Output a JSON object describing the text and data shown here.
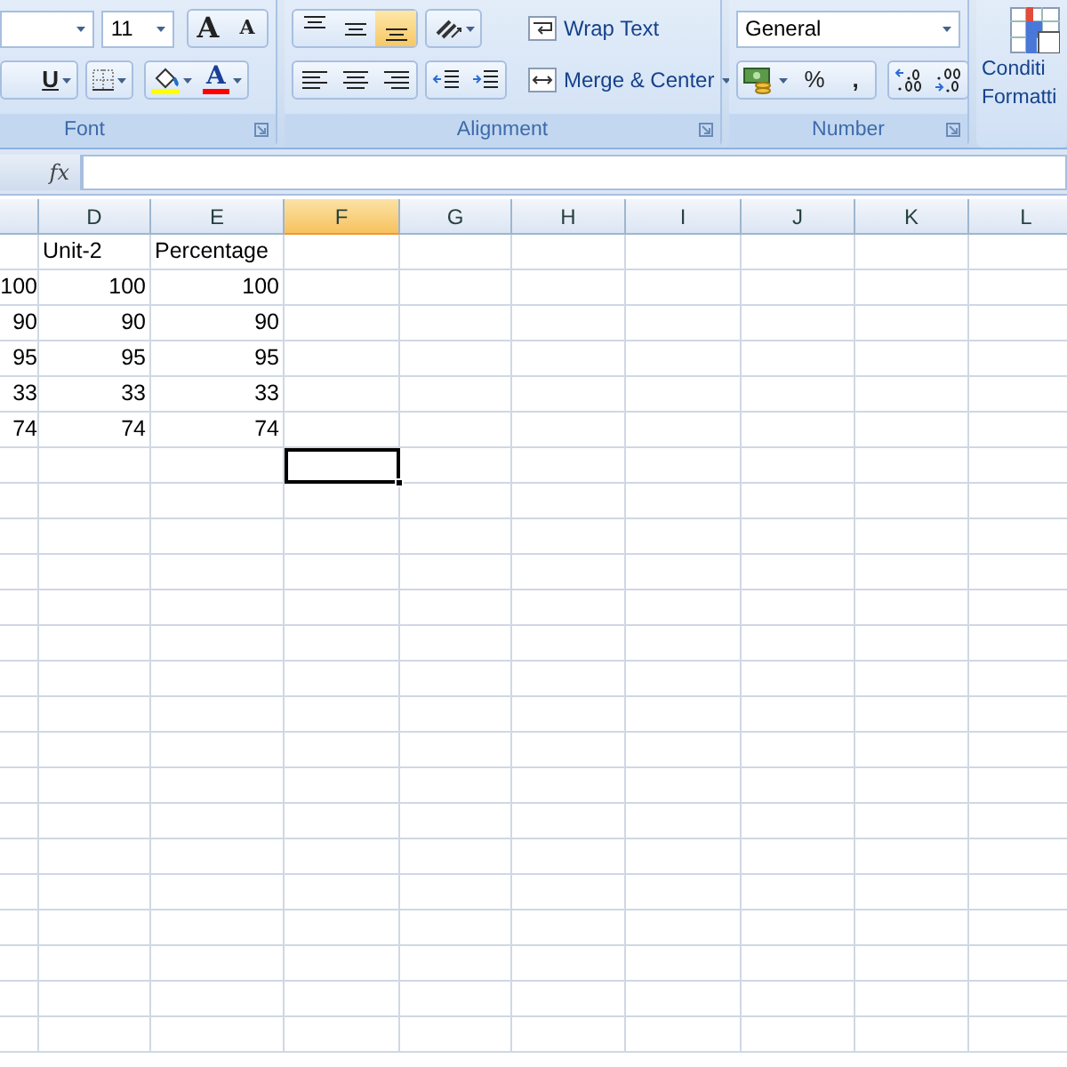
{
  "ribbon": {
    "font": {
      "size": "11",
      "grow_label": "A",
      "shrink_label": "A",
      "underline_label": "U",
      "font_color_label": "A",
      "group_label": "Font"
    },
    "alignment": {
      "vertical": [
        {
          "kind": "top",
          "selected": false
        },
        {
          "kind": "middle",
          "selected": false
        },
        {
          "kind": "bottom",
          "selected": true
        }
      ],
      "horizontal": [
        {
          "kind": "left",
          "selected": false
        },
        {
          "kind": "center",
          "selected": false
        },
        {
          "kind": "right",
          "selected": false
        }
      ],
      "wrap_text": "Wrap Text",
      "merge_center": "Merge & Center",
      "group_label": "Alignment"
    },
    "number": {
      "format": "General",
      "percent": "%",
      "comma": ",",
      "group_label": "Number"
    },
    "styles": {
      "conditional_formatting": [
        "Conditi",
        "Formatti"
      ]
    }
  },
  "formula_bar": {
    "fx": "fx"
  },
  "sheet": {
    "columns": [
      {
        "label": "D",
        "selected": false
      },
      {
        "label": "E",
        "selected": false
      },
      {
        "label": "F",
        "selected": true
      },
      {
        "label": "G",
        "selected": false
      },
      {
        "label": "H",
        "selected": false
      },
      {
        "label": "I",
        "selected": false
      },
      {
        "label": "J",
        "selected": false
      },
      {
        "label": "K",
        "selected": false
      },
      {
        "label": "L",
        "selected": false
      }
    ],
    "rows": [
      {
        "d": "Unit-2",
        "e": "Percentage",
        "selected": false
      },
      {
        "c": "100",
        "d": "100",
        "e": "100",
        "selected": false
      },
      {
        "c": "90",
        "d": "90",
        "e": "90",
        "selected": false
      },
      {
        "c": "95",
        "d": "95",
        "e": "95",
        "selected": false
      },
      {
        "c": "33",
        "d": "33",
        "e": "33",
        "selected": false
      },
      {
        "c": "74",
        "d": "74",
        "e": "74",
        "selected": false
      },
      {
        "selected": true
      },
      {
        "selected": false
      },
      {
        "selected": false
      },
      {
        "selected": false
      },
      {
        "selected": false
      },
      {
        "selected": false
      },
      {
        "selected": false
      },
      {
        "selected": false
      },
      {
        "selected": false
      },
      {
        "selected": false
      },
      {
        "selected": false
      },
      {
        "selected": false
      },
      {
        "selected": false
      },
      {
        "selected": false
      },
      {
        "selected": false
      },
      {
        "selected": false
      },
      {
        "selected": false
      }
    ]
  }
}
